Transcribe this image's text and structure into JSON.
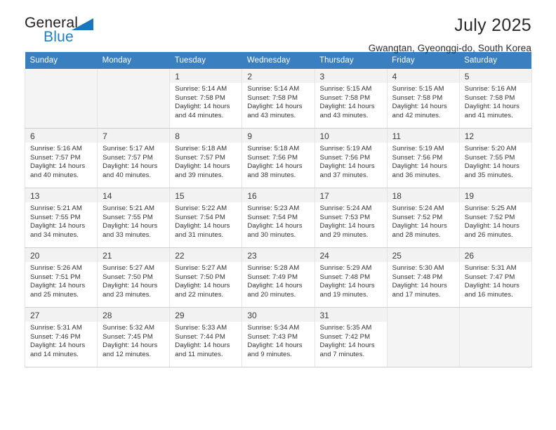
{
  "brand": {
    "name_part1": "General",
    "name_part2": "Blue",
    "triangle_icon": "triangle-icon",
    "accent_color": "#1a76bc"
  },
  "header": {
    "title": "July 2025",
    "subtitle": "Gwangtan, Gyeonggi-do, South Korea"
  },
  "calendar": {
    "header_color": "#3a7fc0",
    "weekday_headers": [
      "Sunday",
      "Monday",
      "Tuesday",
      "Wednesday",
      "Thursday",
      "Friday",
      "Saturday"
    ],
    "labels": {
      "sunrise": "Sunrise:",
      "sunset": "Sunset:",
      "daylight": "Daylight:"
    },
    "weeks": [
      [
        {
          "day": "",
          "sunrise": "",
          "sunset": "",
          "daylight_line1": "",
          "daylight_line2": ""
        },
        {
          "day": "",
          "sunrise": "",
          "sunset": "",
          "daylight_line1": "",
          "daylight_line2": ""
        },
        {
          "day": "1",
          "sunrise": "Sunrise: 5:14 AM",
          "sunset": "Sunset: 7:58 PM",
          "daylight_line1": "Daylight: 14 hours",
          "daylight_line2": "and 44 minutes."
        },
        {
          "day": "2",
          "sunrise": "Sunrise: 5:14 AM",
          "sunset": "Sunset: 7:58 PM",
          "daylight_line1": "Daylight: 14 hours",
          "daylight_line2": "and 43 minutes."
        },
        {
          "day": "3",
          "sunrise": "Sunrise: 5:15 AM",
          "sunset": "Sunset: 7:58 PM",
          "daylight_line1": "Daylight: 14 hours",
          "daylight_line2": "and 43 minutes."
        },
        {
          "day": "4",
          "sunrise": "Sunrise: 5:15 AM",
          "sunset": "Sunset: 7:58 PM",
          "daylight_line1": "Daylight: 14 hours",
          "daylight_line2": "and 42 minutes."
        },
        {
          "day": "5",
          "sunrise": "Sunrise: 5:16 AM",
          "sunset": "Sunset: 7:58 PM",
          "daylight_line1": "Daylight: 14 hours",
          "daylight_line2": "and 41 minutes."
        }
      ],
      [
        {
          "day": "6",
          "sunrise": "Sunrise: 5:16 AM",
          "sunset": "Sunset: 7:57 PM",
          "daylight_line1": "Daylight: 14 hours",
          "daylight_line2": "and 40 minutes."
        },
        {
          "day": "7",
          "sunrise": "Sunrise: 5:17 AM",
          "sunset": "Sunset: 7:57 PM",
          "daylight_line1": "Daylight: 14 hours",
          "daylight_line2": "and 40 minutes."
        },
        {
          "day": "8",
          "sunrise": "Sunrise: 5:18 AM",
          "sunset": "Sunset: 7:57 PM",
          "daylight_line1": "Daylight: 14 hours",
          "daylight_line2": "and 39 minutes."
        },
        {
          "day": "9",
          "sunrise": "Sunrise: 5:18 AM",
          "sunset": "Sunset: 7:56 PM",
          "daylight_line1": "Daylight: 14 hours",
          "daylight_line2": "and 38 minutes."
        },
        {
          "day": "10",
          "sunrise": "Sunrise: 5:19 AM",
          "sunset": "Sunset: 7:56 PM",
          "daylight_line1": "Daylight: 14 hours",
          "daylight_line2": "and 37 minutes."
        },
        {
          "day": "11",
          "sunrise": "Sunrise: 5:19 AM",
          "sunset": "Sunset: 7:56 PM",
          "daylight_line1": "Daylight: 14 hours",
          "daylight_line2": "and 36 minutes."
        },
        {
          "day": "12",
          "sunrise": "Sunrise: 5:20 AM",
          "sunset": "Sunset: 7:55 PM",
          "daylight_line1": "Daylight: 14 hours",
          "daylight_line2": "and 35 minutes."
        }
      ],
      [
        {
          "day": "13",
          "sunrise": "Sunrise: 5:21 AM",
          "sunset": "Sunset: 7:55 PM",
          "daylight_line1": "Daylight: 14 hours",
          "daylight_line2": "and 34 minutes."
        },
        {
          "day": "14",
          "sunrise": "Sunrise: 5:21 AM",
          "sunset": "Sunset: 7:55 PM",
          "daylight_line1": "Daylight: 14 hours",
          "daylight_line2": "and 33 minutes."
        },
        {
          "day": "15",
          "sunrise": "Sunrise: 5:22 AM",
          "sunset": "Sunset: 7:54 PM",
          "daylight_line1": "Daylight: 14 hours",
          "daylight_line2": "and 31 minutes."
        },
        {
          "day": "16",
          "sunrise": "Sunrise: 5:23 AM",
          "sunset": "Sunset: 7:54 PM",
          "daylight_line1": "Daylight: 14 hours",
          "daylight_line2": "and 30 minutes."
        },
        {
          "day": "17",
          "sunrise": "Sunrise: 5:24 AM",
          "sunset": "Sunset: 7:53 PM",
          "daylight_line1": "Daylight: 14 hours",
          "daylight_line2": "and 29 minutes."
        },
        {
          "day": "18",
          "sunrise": "Sunrise: 5:24 AM",
          "sunset": "Sunset: 7:52 PM",
          "daylight_line1": "Daylight: 14 hours",
          "daylight_line2": "and 28 minutes."
        },
        {
          "day": "19",
          "sunrise": "Sunrise: 5:25 AM",
          "sunset": "Sunset: 7:52 PM",
          "daylight_line1": "Daylight: 14 hours",
          "daylight_line2": "and 26 minutes."
        }
      ],
      [
        {
          "day": "20",
          "sunrise": "Sunrise: 5:26 AM",
          "sunset": "Sunset: 7:51 PM",
          "daylight_line1": "Daylight: 14 hours",
          "daylight_line2": "and 25 minutes."
        },
        {
          "day": "21",
          "sunrise": "Sunrise: 5:27 AM",
          "sunset": "Sunset: 7:50 PM",
          "daylight_line1": "Daylight: 14 hours",
          "daylight_line2": "and 23 minutes."
        },
        {
          "day": "22",
          "sunrise": "Sunrise: 5:27 AM",
          "sunset": "Sunset: 7:50 PM",
          "daylight_line1": "Daylight: 14 hours",
          "daylight_line2": "and 22 minutes."
        },
        {
          "day": "23",
          "sunrise": "Sunrise: 5:28 AM",
          "sunset": "Sunset: 7:49 PM",
          "daylight_line1": "Daylight: 14 hours",
          "daylight_line2": "and 20 minutes."
        },
        {
          "day": "24",
          "sunrise": "Sunrise: 5:29 AM",
          "sunset": "Sunset: 7:48 PM",
          "daylight_line1": "Daylight: 14 hours",
          "daylight_line2": "and 19 minutes."
        },
        {
          "day": "25",
          "sunrise": "Sunrise: 5:30 AM",
          "sunset": "Sunset: 7:48 PM",
          "daylight_line1": "Daylight: 14 hours",
          "daylight_line2": "and 17 minutes."
        },
        {
          "day": "26",
          "sunrise": "Sunrise: 5:31 AM",
          "sunset": "Sunset: 7:47 PM",
          "daylight_line1": "Daylight: 14 hours",
          "daylight_line2": "and 16 minutes."
        }
      ],
      [
        {
          "day": "27",
          "sunrise": "Sunrise: 5:31 AM",
          "sunset": "Sunset: 7:46 PM",
          "daylight_line1": "Daylight: 14 hours",
          "daylight_line2": "and 14 minutes."
        },
        {
          "day": "28",
          "sunrise": "Sunrise: 5:32 AM",
          "sunset": "Sunset: 7:45 PM",
          "daylight_line1": "Daylight: 14 hours",
          "daylight_line2": "and 12 minutes."
        },
        {
          "day": "29",
          "sunrise": "Sunrise: 5:33 AM",
          "sunset": "Sunset: 7:44 PM",
          "daylight_line1": "Daylight: 14 hours",
          "daylight_line2": "and 11 minutes."
        },
        {
          "day": "30",
          "sunrise": "Sunrise: 5:34 AM",
          "sunset": "Sunset: 7:43 PM",
          "daylight_line1": "Daylight: 14 hours",
          "daylight_line2": "and 9 minutes."
        },
        {
          "day": "31",
          "sunrise": "Sunrise: 5:35 AM",
          "sunset": "Sunset: 7:42 PM",
          "daylight_line1": "Daylight: 14 hours",
          "daylight_line2": "and 7 minutes."
        },
        {
          "day": "",
          "sunrise": "",
          "sunset": "",
          "daylight_line1": "",
          "daylight_line2": ""
        },
        {
          "day": "",
          "sunrise": "",
          "sunset": "",
          "daylight_line1": "",
          "daylight_line2": ""
        }
      ]
    ]
  }
}
